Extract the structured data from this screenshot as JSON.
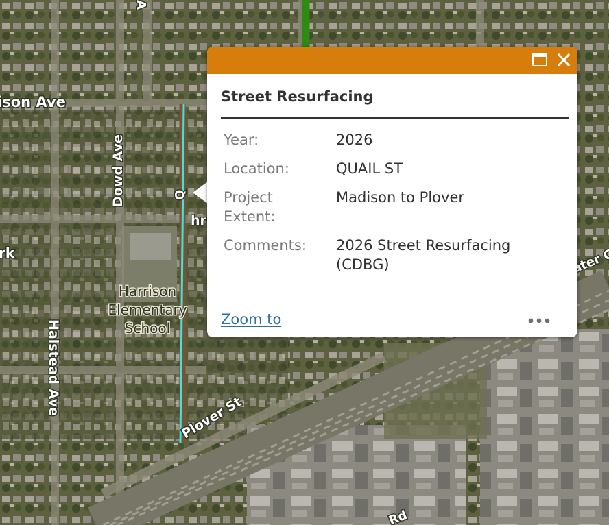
{
  "map": {
    "streets": {
      "madison": "ison Ave",
      "dowd": "Dowd Ave",
      "halstead": "Halstead Ave",
      "plover": "Plover St",
      "quail_partial": "Q",
      "cut_a": "A",
      "cut_rk": "rk",
      "cut_ater": "ater C",
      "cut_rd": "Rd",
      "cut_hr": "hr"
    },
    "school_lines": [
      "Harrison",
      "Elementary",
      "School"
    ],
    "colors": {
      "highlight": "#3ce3e0",
      "resurfacing_line": "#7a5230",
      "other_project_line": "#2e8a12"
    }
  },
  "popup": {
    "header_color": "#d67d0c",
    "maximize_icon": "maximize-icon",
    "close_icon": "close-icon",
    "title": "Street Resurfacing",
    "fields": [
      {
        "label": "Year:",
        "value": "2026"
      },
      {
        "label": "Location:",
        "value": "QUAIL ST"
      },
      {
        "label": "Project Extent:",
        "value": "Madison to Plover"
      },
      {
        "label": "Comments:",
        "value": "2026 Street Resurfacing (CDBG)"
      }
    ],
    "zoom_label": "Zoom to",
    "more_icon": "ellipsis-icon"
  }
}
